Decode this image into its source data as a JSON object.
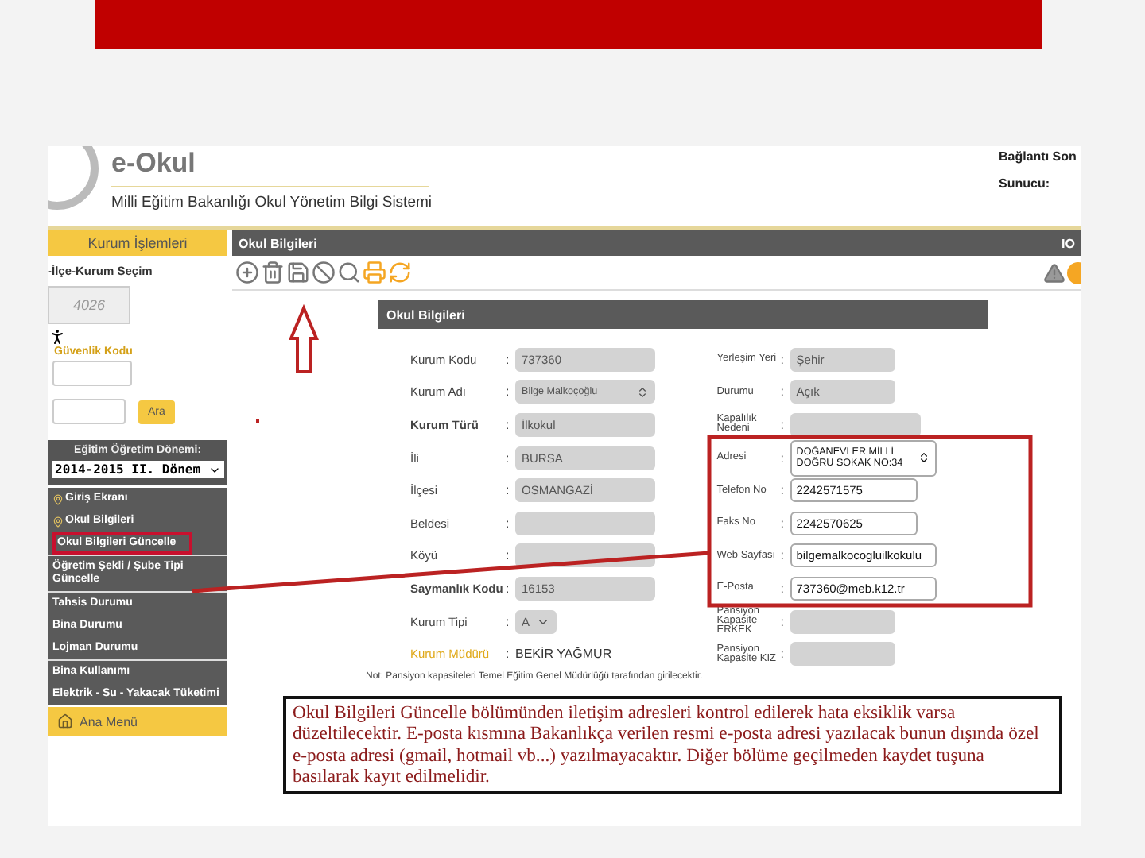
{
  "header": {
    "brand": "e-Okul",
    "subtitle": "Milli Eğitim Bakanlığı Okul Yönetim Bilgi Sistemi",
    "connection_label": "Bağlantı Son",
    "server_label": "Sunucu:"
  },
  "sidebar": {
    "tab": "Kurum İşlemleri",
    "section_title": "-İlçe-Kurum Seçim",
    "captcha": "4026",
    "security_label": "Güvenlik Kodu",
    "search_button": "Ara",
    "term_label": "Eğitim Öğretim Dönemi:",
    "term_value": "2014-2015 II. Dönem",
    "items": [
      {
        "label": "Giriş Ekranı",
        "selected": false,
        "pin": true
      },
      {
        "label": "Okul Bilgileri",
        "selected": false,
        "pin": true
      },
      {
        "label": "Okul Bilgileri Güncelle",
        "selected": true,
        "pin": false
      },
      {
        "label": "Öğretim Şekli / Şube Tipi Güncelle",
        "selected": false,
        "pin": false
      },
      {
        "label": "Tahsis Durumu",
        "selected": false,
        "pin": false
      },
      {
        "label": "Bina Durumu",
        "selected": false,
        "pin": false
      },
      {
        "label": "Lojman Durumu",
        "selected": false,
        "pin": false
      },
      {
        "label": "Bina Kullanımı",
        "selected": false,
        "pin": false
      },
      {
        "label": "Elektrik - Su - Yakacak Tüketimi",
        "selected": false,
        "pin": false
      }
    ],
    "main_menu": "Ana Menü"
  },
  "page_title": "Okul Bilgileri",
  "page_title_right": "IO",
  "form": {
    "title": "Okul Bilgileri",
    "left": [
      {
        "label": "Kurum Kodu",
        "colon": ":",
        "value": "737360",
        "kind": "text",
        "editable": false,
        "bold": false
      },
      {
        "label": "Kurum Adı",
        "colon": ":",
        "value": "Bilge Malkoçoğlu",
        "kind": "textarea",
        "editable": false,
        "bold": false
      },
      {
        "label": "Kurum Türü",
        "colon": ":",
        "value": "İlkokul",
        "kind": "text",
        "editable": false,
        "bold": true
      },
      {
        "label": "İli",
        "colon": ":",
        "value": "BURSA",
        "kind": "text",
        "editable": false,
        "bold": false
      },
      {
        "label": "İlçesi",
        "colon": ":",
        "value": "OSMANGAZİ",
        "kind": "text",
        "editable": false,
        "bold": false
      },
      {
        "label": "Beldesi",
        "colon": ":",
        "kind": "text",
        "editable": false,
        "bold": false
      },
      {
        "label": "Köyü",
        "colon": ":",
        "kind": "text",
        "editable": false,
        "bold": false
      },
      {
        "label": "Saymanlık Kodu",
        "colon": ":",
        "value": "16153",
        "kind": "text",
        "editable": false,
        "bold": true
      },
      {
        "label": "Kurum Tipi",
        "colon": ":",
        "value": "A",
        "kind": "select",
        "editable": false,
        "bold": false
      },
      {
        "label": "Kurum Müdürü",
        "colon": ":",
        "value": "BEKİR YAĞMUR",
        "kind": "static",
        "bold": false
      }
    ],
    "right": [
      {
        "label": "Yerleşim Yeri",
        "colon": ":",
        "value": "Şehir",
        "kind": "text",
        "editable": false
      },
      {
        "label": "Durumu",
        "colon": ":",
        "value": "Açık",
        "kind": "text",
        "editable": false
      },
      {
        "label": "Kapalılık Nedeni",
        "colon": ":",
        "kind": "text",
        "editable": false
      },
      {
        "label": "Adresi",
        "colon": ":",
        "value": "DOĞANEVLER MİLLİ DOĞRU SOKAK NO:34",
        "kind": "textarea",
        "editable": true
      },
      {
        "label": "Telefon No",
        "colon": ":",
        "value": "2242571575",
        "kind": "text",
        "editable": true
      },
      {
        "label": "Faks No",
        "colon": ":",
        "value": "2242570625",
        "kind": "text",
        "editable": true
      },
      {
        "label": "Web Sayfası",
        "colon": ":",
        "value": "bilgemalkocogluilkokulu",
        "kind": "text",
        "editable": true
      },
      {
        "label": "E-Posta",
        "colon": ":",
        "value": "737360@meb.k12.tr",
        "kind": "text",
        "editable": true
      },
      {
        "label": "Pansiyon Kapasite ERKEK",
        "colon": ":",
        "kind": "text",
        "editable": false
      },
      {
        "label": "Pansiyon Kapasite KIZ",
        "colon": ":",
        "kind": "text",
        "editable": false
      }
    ],
    "note": "Not: Pansiyon kapasiteleri Temel Eğitim Genel Müdürlüğü tarafından girilecektir."
  },
  "callout": "Okul Bilgileri Güncelle bölümünden iletişim adresleri kontrol edilerek hata eksiklik varsa düzeltilecektir. E-posta kısmına Bakanlıkça verilen resmi e-posta adresi yazılacak bunun dışında özel e-posta adresi (gmail, hotmail vb...) yazılmayacaktır. Diğer bölüme geçilmeden kaydet tuşuna basılarak kayıt edilmelidir."
}
